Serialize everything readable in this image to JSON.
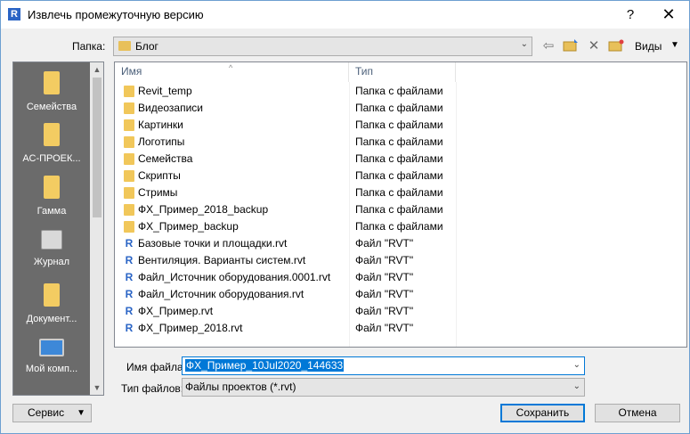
{
  "window": {
    "title": "Извлечь промежуточную версию",
    "help_label": "?",
    "close_label": "✕"
  },
  "folder_bar": {
    "label": "Папка:",
    "current_folder": "Блог",
    "views_label": "Виды"
  },
  "places": [
    {
      "label": "Семейства",
      "icon": "folder-icon"
    },
    {
      "label": "АС-ПРОЕК...",
      "icon": "folder-icon"
    },
    {
      "label": "Гамма",
      "icon": "folder-icon"
    },
    {
      "label": "Журнал",
      "icon": "journal-icon"
    },
    {
      "label": "Документ...",
      "icon": "documents-icon"
    },
    {
      "label": "Мой комп...",
      "icon": "computer-icon"
    }
  ],
  "file_list": {
    "columns": {
      "name": "Имя",
      "type": "Тип"
    },
    "rows": [
      {
        "name": "Revit_temp",
        "type": "Папка с файлами",
        "kind": "folder"
      },
      {
        "name": "Видеозаписи",
        "type": "Папка с файлами",
        "kind": "folder"
      },
      {
        "name": "Картинки",
        "type": "Папка с файлами",
        "kind": "folder"
      },
      {
        "name": "Логотипы",
        "type": "Папка с файлами",
        "kind": "folder"
      },
      {
        "name": "Семейства",
        "type": "Папка с файлами",
        "kind": "folder"
      },
      {
        "name": "Скрипты",
        "type": "Папка с файлами",
        "kind": "folder"
      },
      {
        "name": "Стримы",
        "type": "Папка с файлами",
        "kind": "folder"
      },
      {
        "name": "ФХ_Пример_2018_backup",
        "type": "Папка с файлами",
        "kind": "folder"
      },
      {
        "name": "ФХ_Пример_backup",
        "type": "Папка с файлами",
        "kind": "folder"
      },
      {
        "name": "Базовые точки и площадки.rvt",
        "type": "Файл \"RVT\"",
        "kind": "rvt"
      },
      {
        "name": "Вентиляция. Варианты систем.rvt",
        "type": "Файл \"RVT\"",
        "kind": "rvt"
      },
      {
        "name": "Файл_Источник оборудования.0001.rvt",
        "type": "Файл \"RVT\"",
        "kind": "rvt"
      },
      {
        "name": "Файл_Источник оборудования.rvt",
        "type": "Файл \"RVT\"",
        "kind": "rvt"
      },
      {
        "name": "ФХ_Пример.rvt",
        "type": "Файл \"RVT\"",
        "kind": "rvt"
      },
      {
        "name": "ФХ_Пример_2018.rvt",
        "type": "Файл \"RVT\"",
        "kind": "rvt"
      }
    ]
  },
  "filename": {
    "label": "Имя файла:",
    "value": "ФХ_Пример_10Jul2020_144633"
  },
  "filetype": {
    "label": "Тип файлов:",
    "value": "Файлы проектов  (*.rvt)"
  },
  "buttons": {
    "service": "Сервис",
    "save": "Сохранить",
    "cancel": "Отмена"
  },
  "colors": {
    "accent": "#0078d7",
    "places_bg": "#6b6b6b",
    "folder": "#f1c75a"
  }
}
